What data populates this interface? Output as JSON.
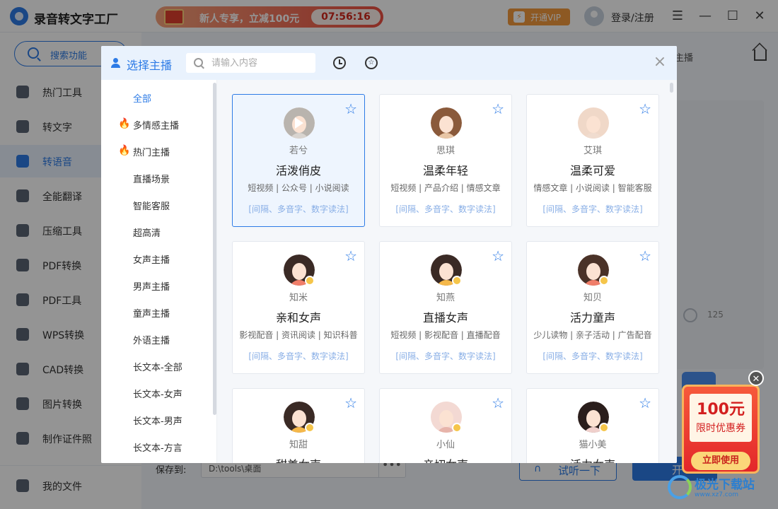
{
  "app": {
    "title": "录音转文字工厂"
  },
  "promo": {
    "text": "新人专享，立减100元",
    "timer": "07:56:16"
  },
  "header": {
    "vip_label": "开通VIP",
    "login_label": "登录/注册"
  },
  "window_controls": {
    "menu": "☰",
    "minimize": "—",
    "maximize": "☐",
    "close": "✕"
  },
  "sidebar": {
    "search_label": "搜索功能",
    "items": [
      {
        "label": "热门工具"
      },
      {
        "label": "转文字"
      },
      {
        "label": "转语音"
      },
      {
        "label": "全能翻译"
      },
      {
        "label": "压缩工具"
      },
      {
        "label": "PDF转换"
      },
      {
        "label": "PDF工具"
      },
      {
        "label": "WPS转换"
      },
      {
        "label": "CAD转换"
      },
      {
        "label": "图片转换"
      },
      {
        "label": "制作证件照"
      }
    ],
    "active_index": 2,
    "bottom_label": "我的文件"
  },
  "main": {
    "tab_fragment": "主播",
    "char_count": "125",
    "save_label": "保存到:",
    "save_path": "D:\\tools\\桌面",
    "more": "•••",
    "trial_label": "试听一下",
    "start_label": "开"
  },
  "modal": {
    "title": "选择主播",
    "search_placeholder": "请输入内容",
    "close": "×",
    "categories": [
      {
        "label": "全部",
        "hot": false
      },
      {
        "label": "多情感主播",
        "hot": true
      },
      {
        "label": "热门主播",
        "hot": true
      },
      {
        "label": "直播场景",
        "hot": false
      },
      {
        "label": "智能客服",
        "hot": false
      },
      {
        "label": "超高清",
        "hot": false
      },
      {
        "label": "女声主播",
        "hot": false
      },
      {
        "label": "男声主播",
        "hot": false
      },
      {
        "label": "童声主播",
        "hot": false
      },
      {
        "label": "外语主播",
        "hot": false
      },
      {
        "label": "长文本-全部",
        "hot": false
      },
      {
        "label": "长文本-女声",
        "hot": false
      },
      {
        "label": "长文本-男声",
        "hot": false
      },
      {
        "label": "长文本-方言",
        "hot": false
      }
    ],
    "fire_glyph": "🔥",
    "fav_glyph": "☆",
    "anchors": [
      {
        "name": "若兮",
        "style": "活泼俏皮",
        "tags": "短视频 | 公众号 | 小说阅读",
        "features": "[间隔、多音字、数字读法]"
      },
      {
        "name": "思琪",
        "style": "温柔年轻",
        "tags": "短视频 | 产品介绍 | 情感文章",
        "features": "[间隔、多音字、数字读法]"
      },
      {
        "name": "艾琪",
        "style": "温柔可爱",
        "tags": "情感文章 | 小说阅读 | 智能客服",
        "features": "[间隔、多音字、数字读法]"
      },
      {
        "name": "知米",
        "style": "亲和女声",
        "tags": "影视配音 | 资讯阅读 | 知识科普",
        "features": "[间隔、多音字、数字读法]"
      },
      {
        "name": "知燕",
        "style": "直播女声",
        "tags": "短视频 | 影视配音 | 直播配音",
        "features": "[间隔、多音字、数字读法]"
      },
      {
        "name": "知贝",
        "style": "活力童声",
        "tags": "少儿读物 | 亲子活动 | 广告配音",
        "features": "[间隔、多音字、数字读法]"
      },
      {
        "name": "知甜",
        "style": "甜美女声",
        "tags": "",
        "features": ""
      },
      {
        "name": "小仙",
        "style": "亲切女声",
        "tags": "",
        "features": ""
      },
      {
        "name": "猫小美",
        "style": "活力女声",
        "tags": "",
        "features": ""
      }
    ]
  },
  "coupon": {
    "amount": "100元",
    "subtitle": "限时优惠券",
    "use_label": "立即使用",
    "close": "✕"
  },
  "watermark": {
    "text": "极光下载站",
    "sub": "www.xz7.com"
  },
  "colors": {
    "accent": "#2d7be6",
    "promo": "#ee4f42",
    "vip": "#f39a3d"
  }
}
